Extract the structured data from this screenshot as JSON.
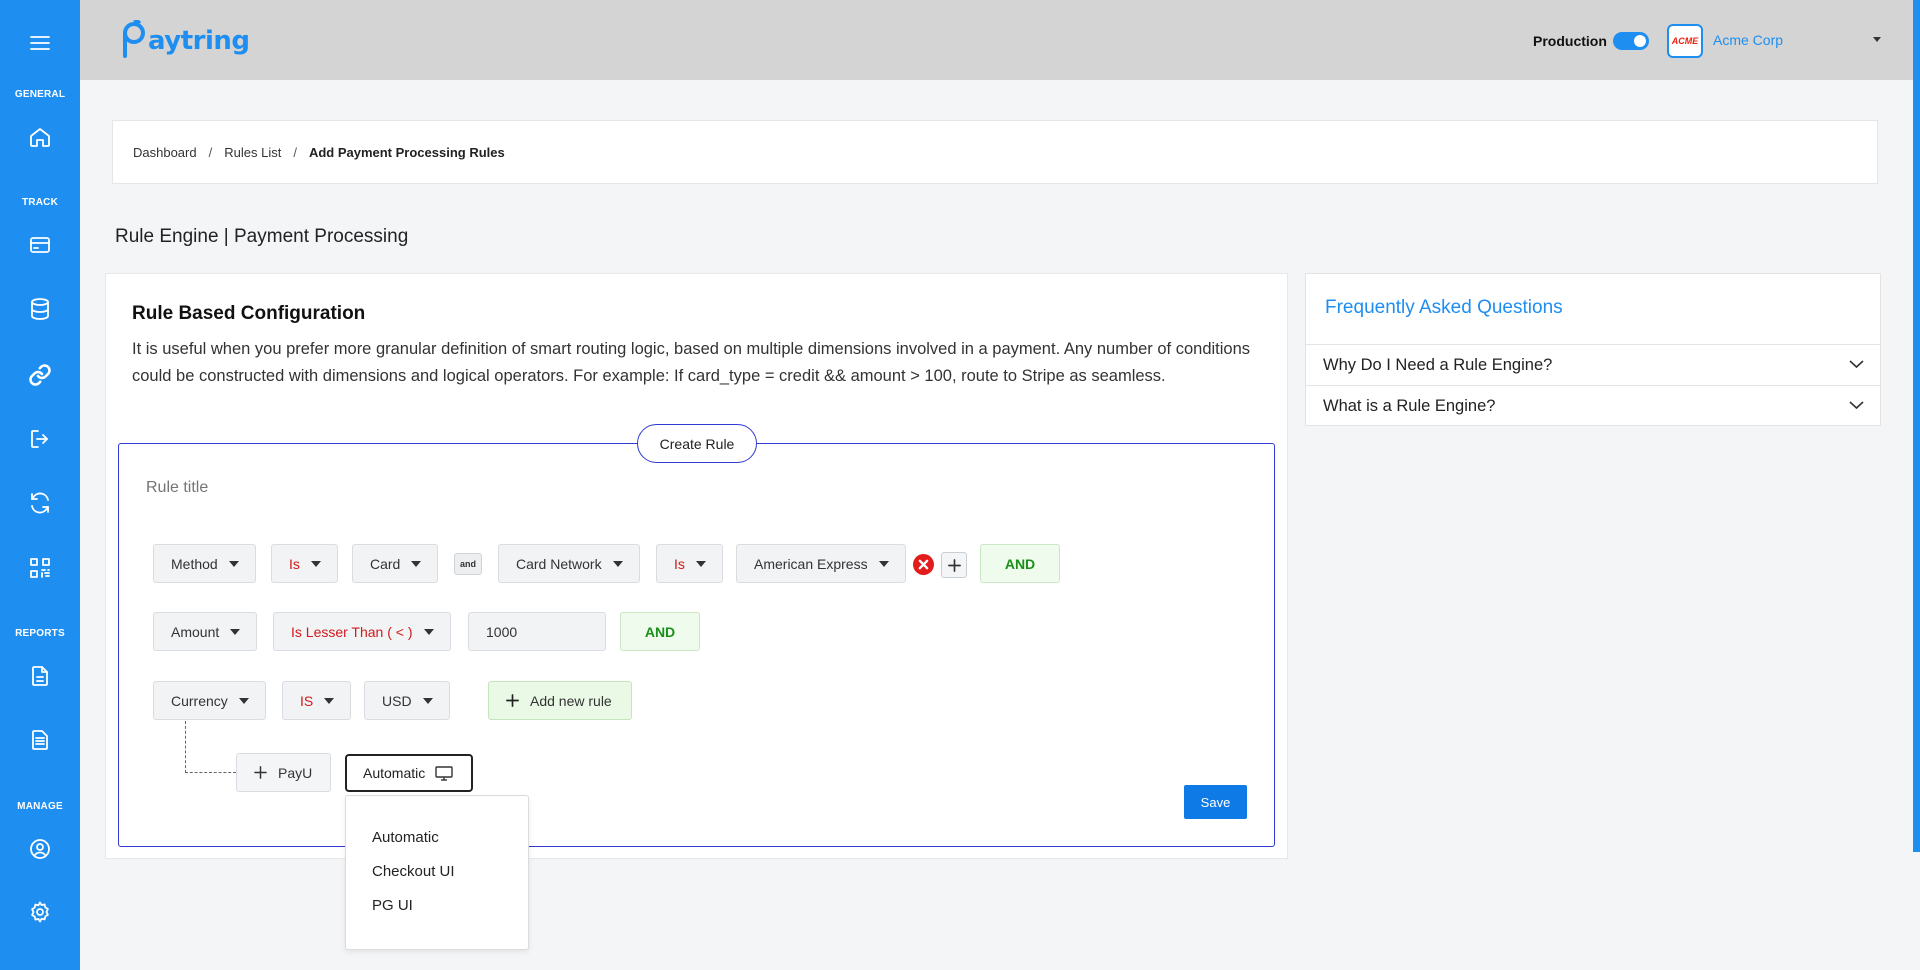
{
  "sidebar": {
    "sections": [
      "GENERAL",
      "TRACK",
      "REPORTS",
      "MANAGE"
    ],
    "icons": [
      "menu-icon",
      "home-icon",
      "credit-card-icon",
      "database-icon",
      "link-icon",
      "logout-icon",
      "refresh-icon",
      "qr-code-icon",
      "document-icon",
      "document-list-icon",
      "user-circle-icon",
      "gear-icon"
    ]
  },
  "header": {
    "logo": "Paytring",
    "logo_visible": "aytring",
    "environment_label": "Production",
    "environment_on": true,
    "org_logo": "ACME",
    "org_name": "Acme Corp"
  },
  "breadcrumb": [
    "Dashboard",
    "Rules List",
    "Add Payment Processing Rules"
  ],
  "page_title": "Rule Engine | Payment Processing",
  "card": {
    "title": "Rule Based Configuration",
    "description": "It is useful when you prefer more granular definition of smart routing logic, based on multiple dimensions involved in a payment. Any number of conditions could be constructed with dimensions and logical operators. For example: If card_type = credit && amount > 100, route to Stripe as seamless."
  },
  "rule_builder": {
    "create_rule_label": "Create Rule",
    "rule_title_placeholder": "Rule title",
    "row1": {
      "field": "Method",
      "operator": "Is",
      "value": "Card",
      "joiner": "and",
      "field2": "Card Network",
      "operator2": "Is",
      "value2": "American Express",
      "logic": "AND"
    },
    "row2": {
      "field": "Amount",
      "operator": "Is Lesser Than ( < )",
      "value": "1000",
      "logic": "AND"
    },
    "row3": {
      "field": "Currency",
      "operator": "IS",
      "value": "USD",
      "add_label": "Add new rule"
    },
    "gateway": {
      "name": "PayU",
      "mode": "Automatic"
    },
    "mode_options": [
      "Automatic",
      "Checkout UI",
      "PG UI"
    ],
    "save_label": "Save"
  },
  "faq": {
    "title": "Frequently Asked Questions",
    "items": [
      "Why Do I Need a Rule Engine?",
      "What is a Rule Engine?"
    ]
  },
  "colors": {
    "brand": "#1e8ef0",
    "rule_border": "#2f3bd3",
    "operator_red": "#d21a1a",
    "logic_green": "#1a8f1a",
    "save_blue": "#0e7ae6"
  }
}
